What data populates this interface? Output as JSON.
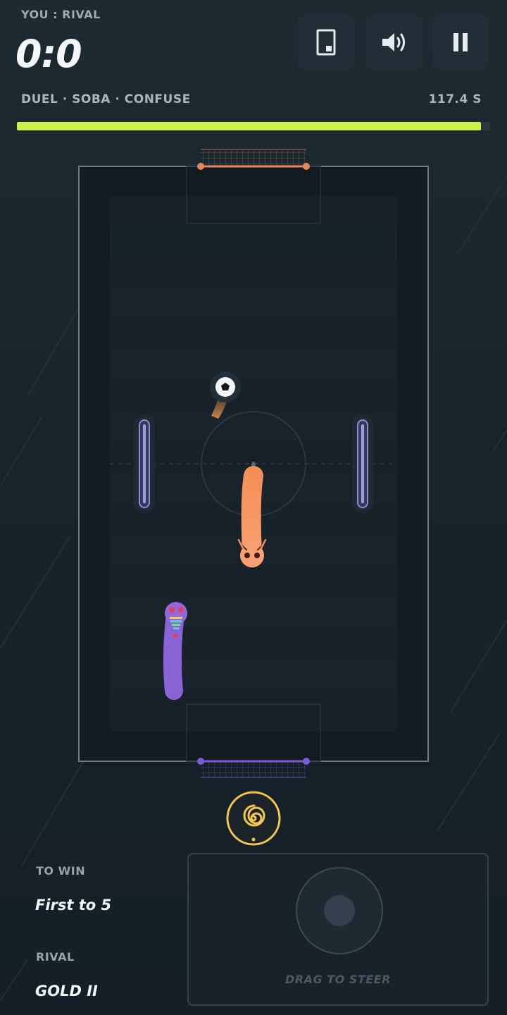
{
  "hud": {
    "players_label": "YOU : RIVAL",
    "score": "0:0",
    "mode_line": "DUEL · SOBA · CONFUSE",
    "timer": "117.4 S",
    "match_progress": 0.98,
    "progress_color": "#c8f34a"
  },
  "buttons": {
    "device_icon": "phone-portrait-icon",
    "sound_icon": "speaker-volume-icon",
    "pause_icon": "pause-icon",
    "ability_icon": "spiral-confuse-icon"
  },
  "field": {
    "top_goal_color": "#e8875a",
    "bottom_goal_color": "#7a5cd6",
    "player_worm_color": "#f5935e",
    "rival_worm_color": "#8a63d6",
    "bumper_color": "#8e86d8"
  },
  "info": {
    "to_win_label": "TO WIN",
    "to_win_value": "First to 5",
    "rival_label": "RIVAL",
    "rival_value": "GOLD II"
  },
  "controls": {
    "steer_hint": "DRAG TO STEER"
  }
}
